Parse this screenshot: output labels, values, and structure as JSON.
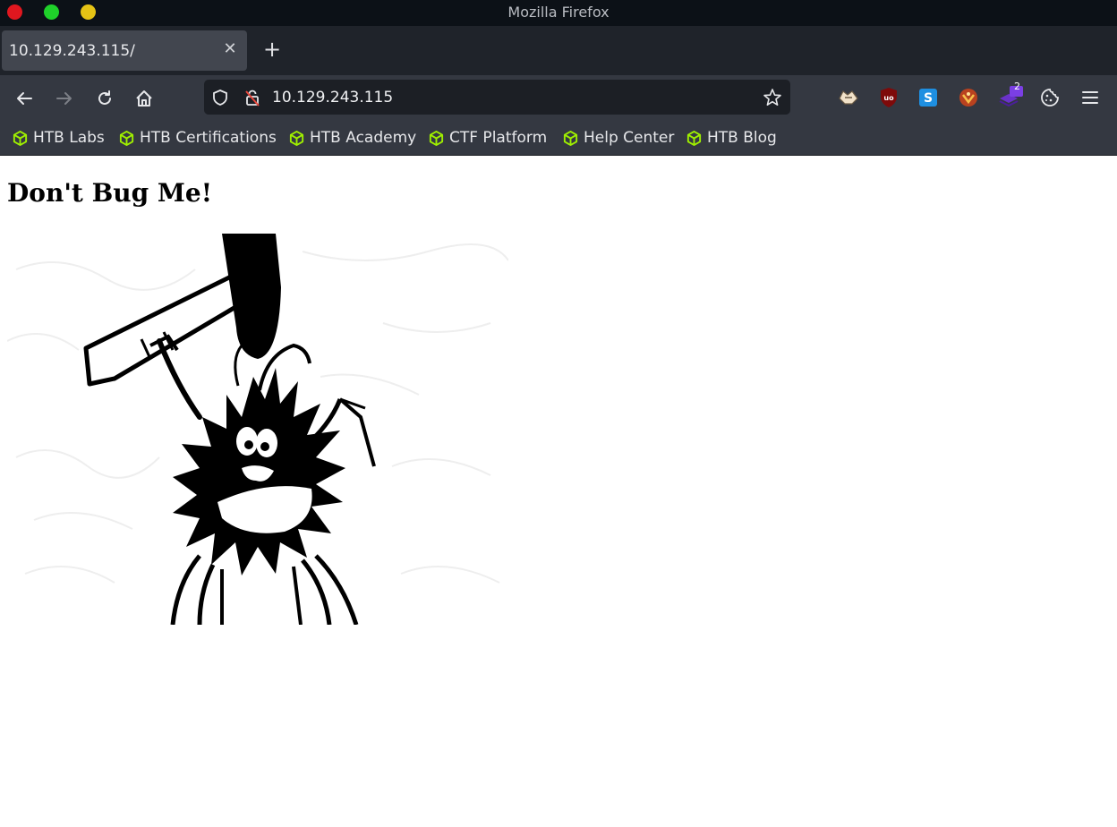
{
  "window": {
    "title": "Mozilla Firefox"
  },
  "tabs": [
    {
      "label": "10.129.243.115/",
      "active": true
    }
  ],
  "toolbar": {
    "url": "10.129.243.115"
  },
  "extensions": {
    "badge_count": "2"
  },
  "bookmarks": [
    {
      "label": "HTB Labs"
    },
    {
      "label": "HTB Certifications"
    },
    {
      "label": "HTB Academy"
    },
    {
      "label": "CTF Platform"
    },
    {
      "label": "Help Center"
    },
    {
      "label": "HTB Blog"
    }
  ],
  "page": {
    "heading": "Don't Bug Me!"
  },
  "colors": {
    "bookmark_icon": "#9fef00",
    "titlebar": "#0c1117",
    "toolbar": "#343841"
  }
}
